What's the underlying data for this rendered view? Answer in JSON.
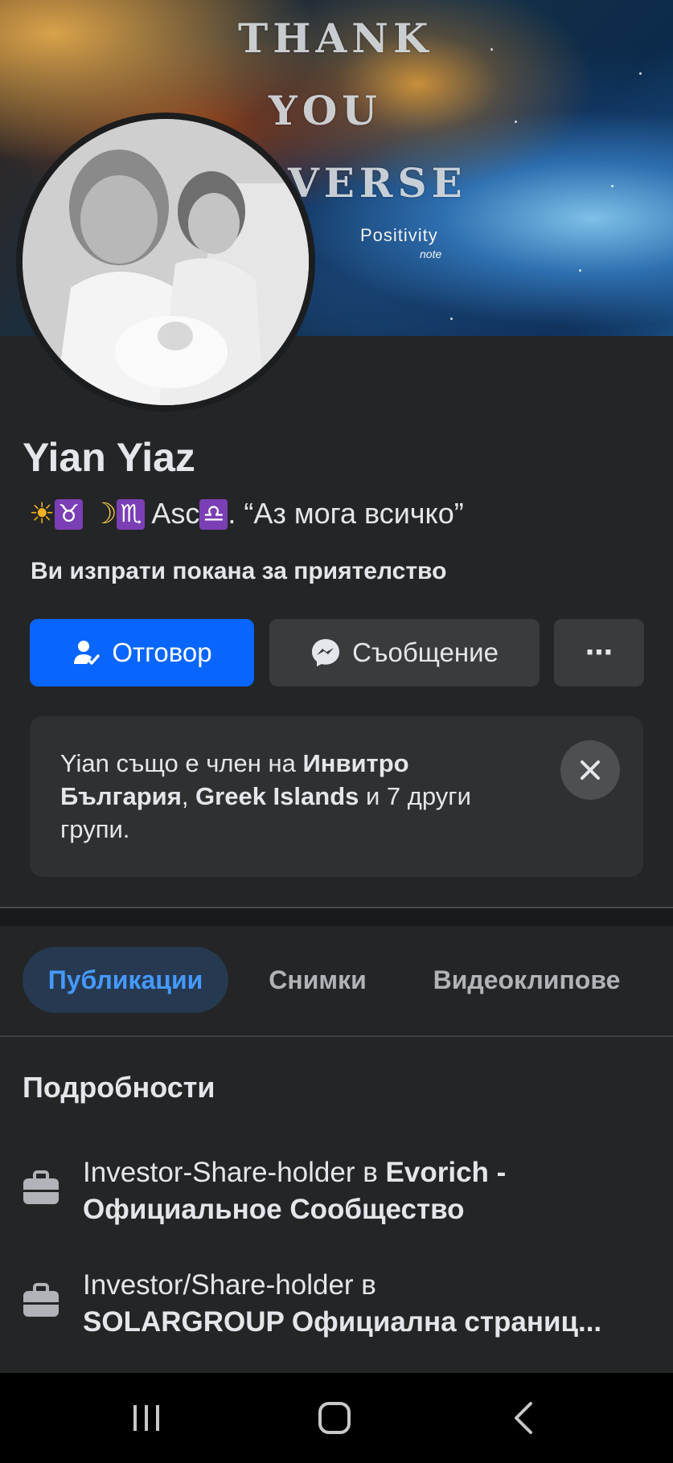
{
  "cover": {
    "lines": [
      "THANK",
      "YOU",
      "VERSE"
    ],
    "brand": "Positivity",
    "brand_sub": "note"
  },
  "profile": {
    "name": "Yian Yiaz",
    "bio_sign1": "♉",
    "bio_sign2": "♏",
    "bio_asc_label": "Asc",
    "bio_sign3": "♎",
    "bio_quote": ". “Аз мога всичко”",
    "friend_request_note": "Ви изпрати покана за приятелство"
  },
  "actions": {
    "reply_label": "Отговор",
    "message_label": "Съобщение",
    "more_label": "⋯"
  },
  "groups_card": {
    "prefix": "Yian също е член на ",
    "group1": "Инвитро България",
    "sep": ", ",
    "group2": "Greek Islands",
    "suffix": " и 7 други групи."
  },
  "tabs": [
    {
      "label": "Публикации",
      "active": true
    },
    {
      "label": "Снимки",
      "active": false
    },
    {
      "label": "Видеоклипове",
      "active": false
    }
  ],
  "details": {
    "title": "Подробности",
    "items": [
      {
        "role": "Investor-Share-holder в ",
        "org_line1": "Evorich -",
        "org_line2": "Официальное Сообщество"
      },
      {
        "role": "Investor/Share-holder в",
        "org_line2": "SOLARGROUP Официална страниц..."
      }
    ]
  },
  "colors": {
    "background": "#242526",
    "primary": "#0866ff",
    "secondary_button": "#3a3b3c",
    "active_tab_bg": "#263951",
    "active_tab_text": "#4599ff"
  },
  "icons": {
    "reply": "person-check-icon",
    "message": "messenger-icon",
    "close": "close-icon",
    "work": "briefcase-icon",
    "nav_recents": "recents-icon",
    "nav_home": "home-icon",
    "nav_back": "back-icon"
  }
}
